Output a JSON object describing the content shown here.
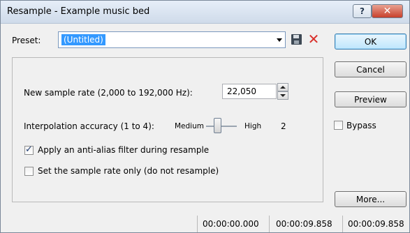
{
  "window": {
    "title": "Resample - Example music bed"
  },
  "titlebar": {
    "help_glyph": "?",
    "close_glyph": "✕"
  },
  "preset": {
    "label": "Preset:",
    "value": "(Untitled)"
  },
  "buttons": {
    "ok": "OK",
    "cancel": "Cancel",
    "preview": "Preview",
    "more": "More..."
  },
  "sample_rate": {
    "label": "New sample rate (2,000 to 192,000 Hz):",
    "value": "22,050"
  },
  "interpolation": {
    "label": "Interpolation accuracy (1 to 4):",
    "min_label": "Medium",
    "max_label": "High",
    "value": "2",
    "level": 2,
    "range": [
      1,
      4
    ]
  },
  "bypass": {
    "label": "Bypass",
    "checked": false
  },
  "options": {
    "anti_alias": {
      "label": "Apply an anti-alias filter during resample",
      "checked": true
    },
    "rate_only": {
      "label": "Set the sample rate only (do not resample)",
      "checked": false
    }
  },
  "status": {
    "start": "00:00:00.000",
    "end": "00:00:09.858",
    "length": "00:00:09.858"
  },
  "icons": {
    "save": "save-icon",
    "delete": "delete-icon",
    "dropdown": "chevron-down-icon"
  },
  "colors": {
    "selection": "#3399ff",
    "delete_icon": "#d9302b",
    "close_button": "#c7402b"
  }
}
